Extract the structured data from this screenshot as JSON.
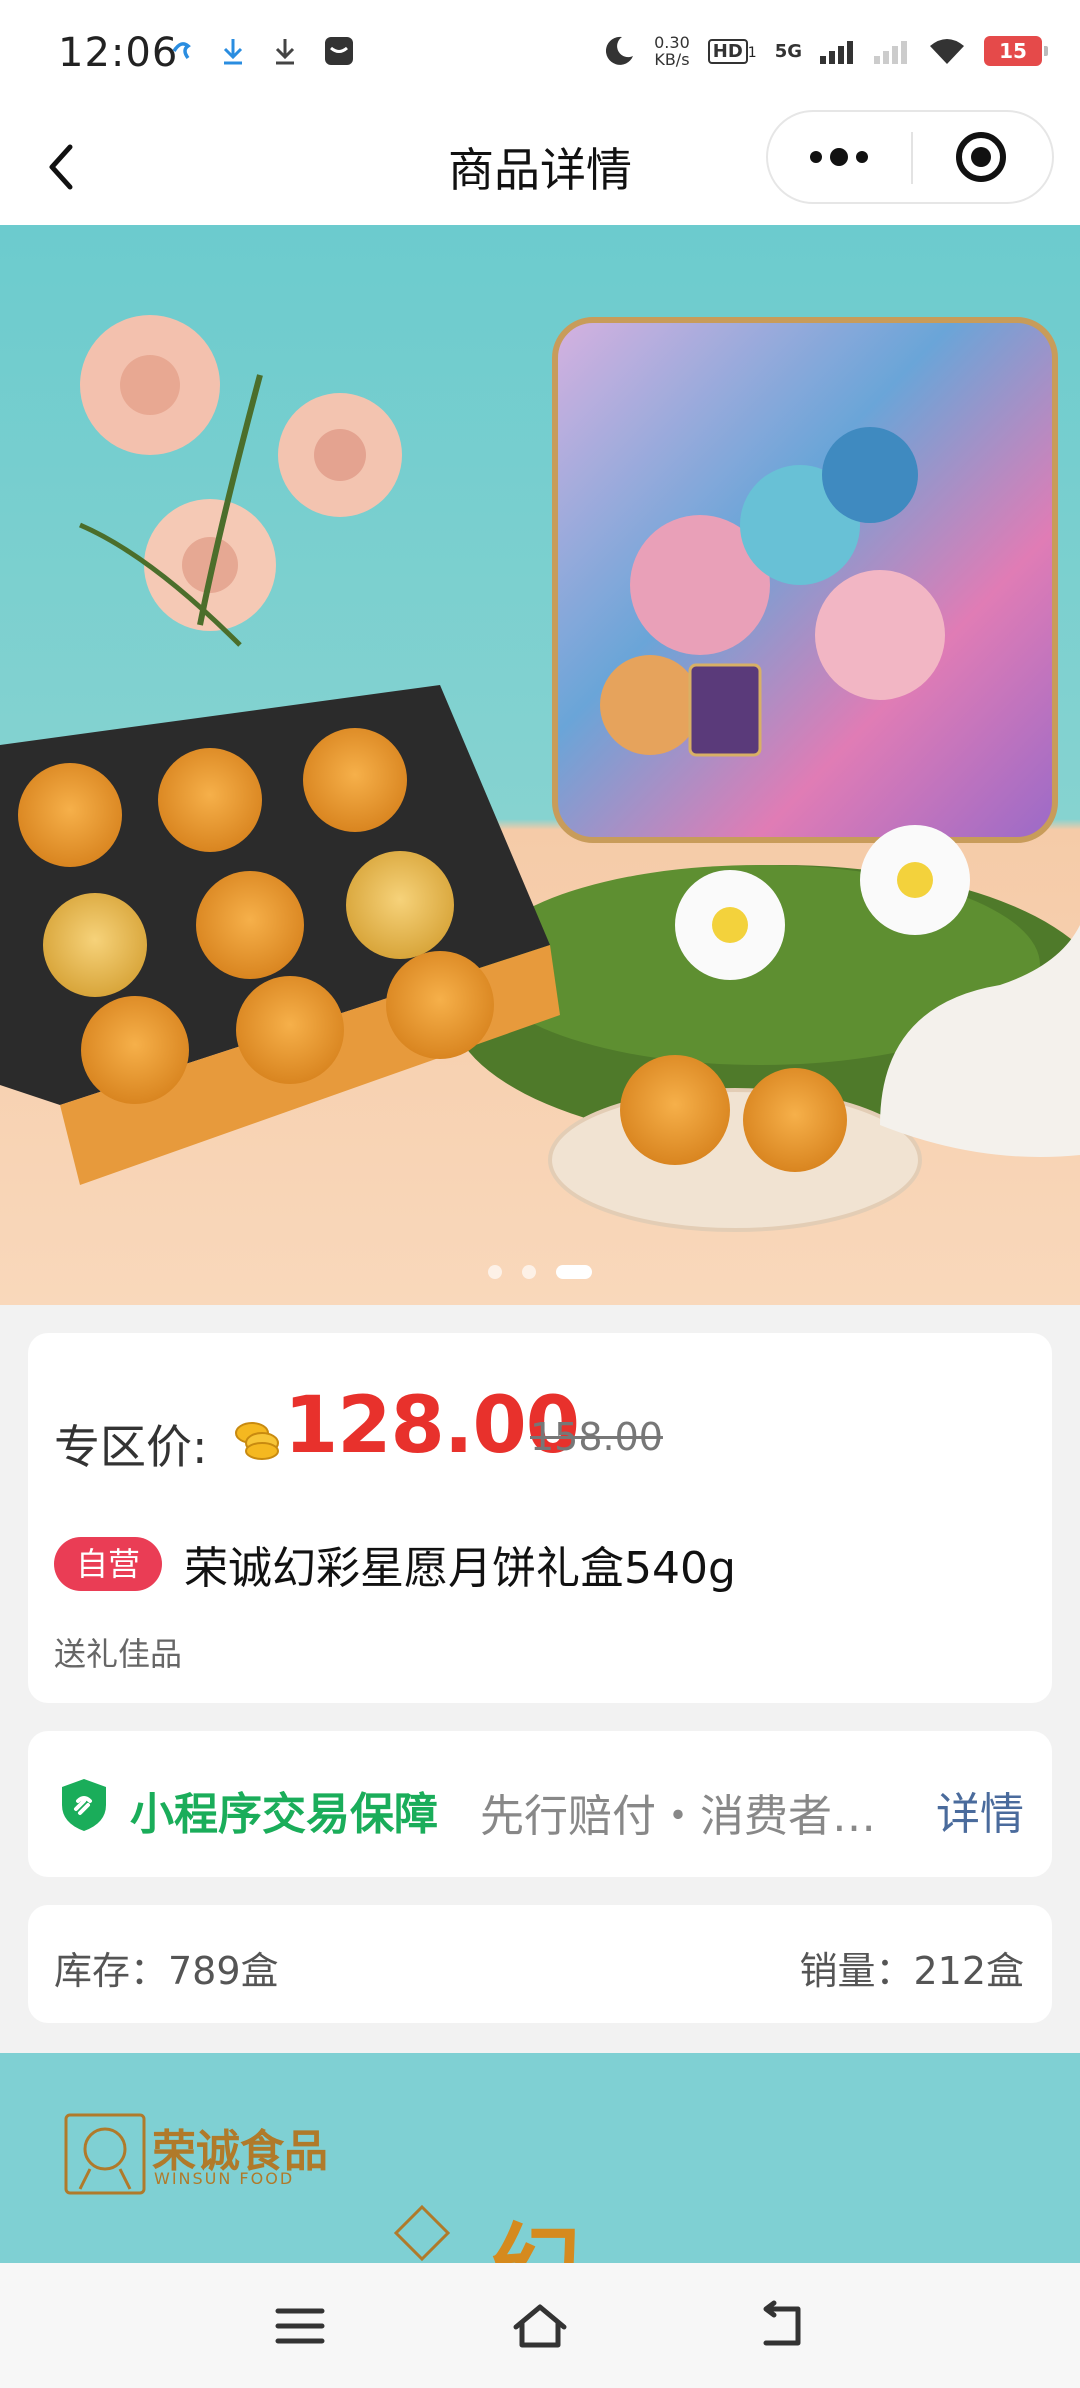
{
  "status_bar": {
    "time": "12:06",
    "net_speed_value": "0.30",
    "net_speed_unit": "KB/s",
    "hd": "HD",
    "hd_sub": "1",
    "network": "5G",
    "battery": "15"
  },
  "nav": {
    "title": "商品详情"
  },
  "gallery": {
    "page_count": 3,
    "active_index": 2
  },
  "price_card": {
    "price_label": "专区价:",
    "price": "128.00",
    "original_price": "158.00",
    "badge": "自营",
    "product_name": "荣诚幻彩星愿月饼礼盒540g",
    "tag": "送礼佳品"
  },
  "guarantee": {
    "title": "小程序交易保障",
    "description": "先行赔付・消费者…",
    "link": "详情"
  },
  "stock_card": {
    "stock": "库存：789盒",
    "sales": "销量：212盒"
  },
  "detail_banner": {
    "brand_cn": "荣诚食品",
    "brand_en": "WINSUN FOOD",
    "title_char": "幻"
  },
  "colors": {
    "price_red": "#e8312c",
    "badge_red": "#ea3d55",
    "guarantee_green": "#1aad5a",
    "link_blue": "#4a6b9c",
    "hero_teal": "#6cc9cc",
    "hero_peach": "#f6c9a6"
  }
}
